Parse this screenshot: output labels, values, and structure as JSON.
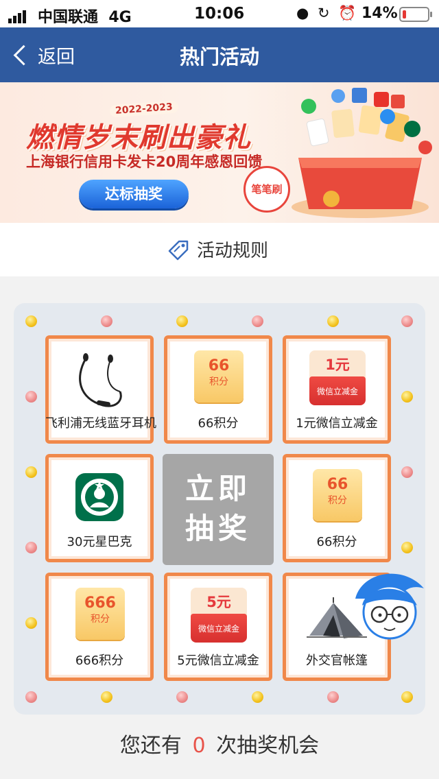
{
  "status_bar": {
    "carrier": "中国联通",
    "network": "4G",
    "time": "10:06",
    "battery_percent": "14%",
    "battery_level": 0.14,
    "icons": [
      "person-icon",
      "rotation-lock-icon",
      "alarm-icon"
    ]
  },
  "nav": {
    "back_label": "返回",
    "title": "热门活动"
  },
  "banner": {
    "year_badge": "2022-2023",
    "headline": "燃情岁末刷出豪礼",
    "subtitle": "上海银行信用卡发卡20周年感恩回馈",
    "button_label": "达标抽奖",
    "stamp_label": "笔笔刷"
  },
  "rules": {
    "label": "活动规则"
  },
  "prizes": [
    {
      "label": "飞利浦无线蓝牙耳机",
      "icon": "earphones-icon"
    },
    {
      "label": "66积分",
      "icon": "points-ticket-icon",
      "ticket_number": "66",
      "ticket_unit": "积分"
    },
    {
      "label": "1元微信立减金",
      "icon": "red-packet-icon",
      "amount": "1元",
      "packet_text": "微信立减金"
    },
    {
      "label": "30元星巴克",
      "icon": "starbucks-logo-icon"
    },
    {
      "label": "66积分",
      "icon": "points-ticket-icon",
      "ticket_number": "66",
      "ticket_unit": "积分"
    },
    {
      "label": "666积分",
      "icon": "points-ticket-icon",
      "ticket_number": "666",
      "ticket_unit": "积分"
    },
    {
      "label": "5元微信立减金",
      "icon": "red-packet-icon",
      "amount": "5元",
      "packet_text": "微信立减金"
    },
    {
      "label": "外交官帐篷",
      "icon": "tent-icon"
    }
  ],
  "draw_button": {
    "line1": "立即",
    "line2": "抽奖"
  },
  "chances": {
    "prefix": "您还有",
    "count": "0",
    "suffix": "次抽奖机会"
  },
  "colors": {
    "nav_bg": "#2f5a9f",
    "cell_border": "#f0884a",
    "draw_button_bg": "#a6a6a6",
    "chances_number": "#e8534a"
  }
}
